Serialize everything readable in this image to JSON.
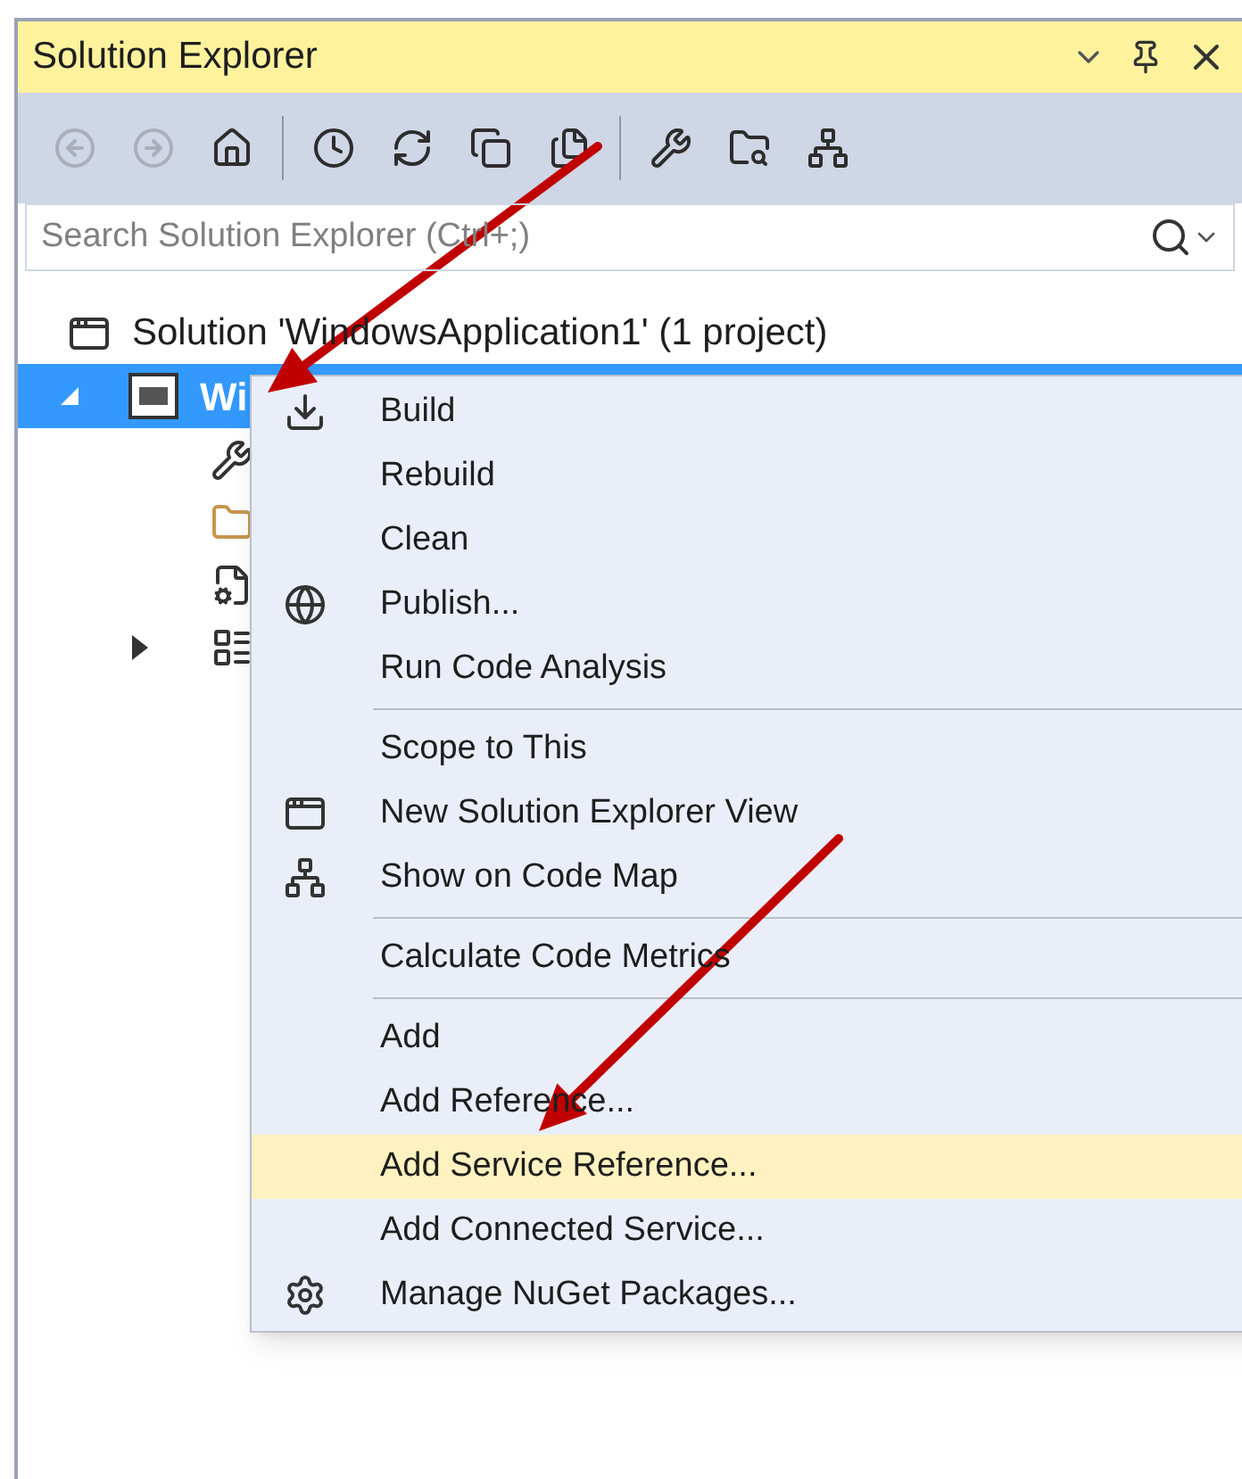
{
  "window": {
    "title": "Solution Explorer"
  },
  "toolbar": [
    {
      "kind": "back",
      "disabled": true
    },
    {
      "kind": "forward",
      "disabled": true
    },
    {
      "kind": "home",
      "disabled": false
    },
    {
      "kind": "separator"
    },
    {
      "kind": "pending",
      "disabled": false
    },
    {
      "kind": "sync",
      "disabled": false
    },
    {
      "kind": "collapse",
      "disabled": false
    },
    {
      "kind": "show-all",
      "disabled": false
    },
    {
      "kind": "separator"
    },
    {
      "kind": "properties",
      "disabled": false
    },
    {
      "kind": "preview",
      "disabled": false
    },
    {
      "kind": "code-map",
      "disabled": false
    }
  ],
  "search": {
    "placeholder": "Search Solution Explorer (Ctrl+;)"
  },
  "tree": {
    "solution": {
      "label": "Solution 'WindowsApplication1' (1 project)"
    },
    "project": {
      "label": "Wi",
      "selected": true,
      "expanded": true,
      "children": [
        {
          "kind": "properties"
        },
        {
          "kind": "folder"
        },
        {
          "kind": "config"
        },
        {
          "kind": "form",
          "expanded": false
        }
      ]
    }
  },
  "context_menu": {
    "groups": [
      [
        {
          "label": "Build",
          "kind": "build",
          "selected": false
        },
        {
          "label": "Rebuild",
          "selected": false
        },
        {
          "label": "Clean",
          "selected": false
        },
        {
          "label": "Publish...",
          "kind": "publish",
          "selected": false
        },
        {
          "label": "Run Code Analysis",
          "selected": false
        }
      ],
      [
        {
          "label": "Scope to This",
          "selected": false
        },
        {
          "label": "New Solution Explorer View",
          "kind": "new-view",
          "selected": false
        },
        {
          "label": "Show on Code Map",
          "kind": "code-map",
          "selected": false
        }
      ],
      [
        {
          "label": "Calculate Code Metrics",
          "selected": false
        }
      ],
      [
        {
          "label": "Add",
          "selected": false
        },
        {
          "label": "Add Reference...",
          "selected": false
        },
        {
          "label": "Add Service Reference...",
          "selected": true
        },
        {
          "label": "Add Connected Service...",
          "selected": false
        },
        {
          "label": "Manage NuGet Packages...",
          "kind": "nuget",
          "selected": false
        }
      ]
    ]
  }
}
